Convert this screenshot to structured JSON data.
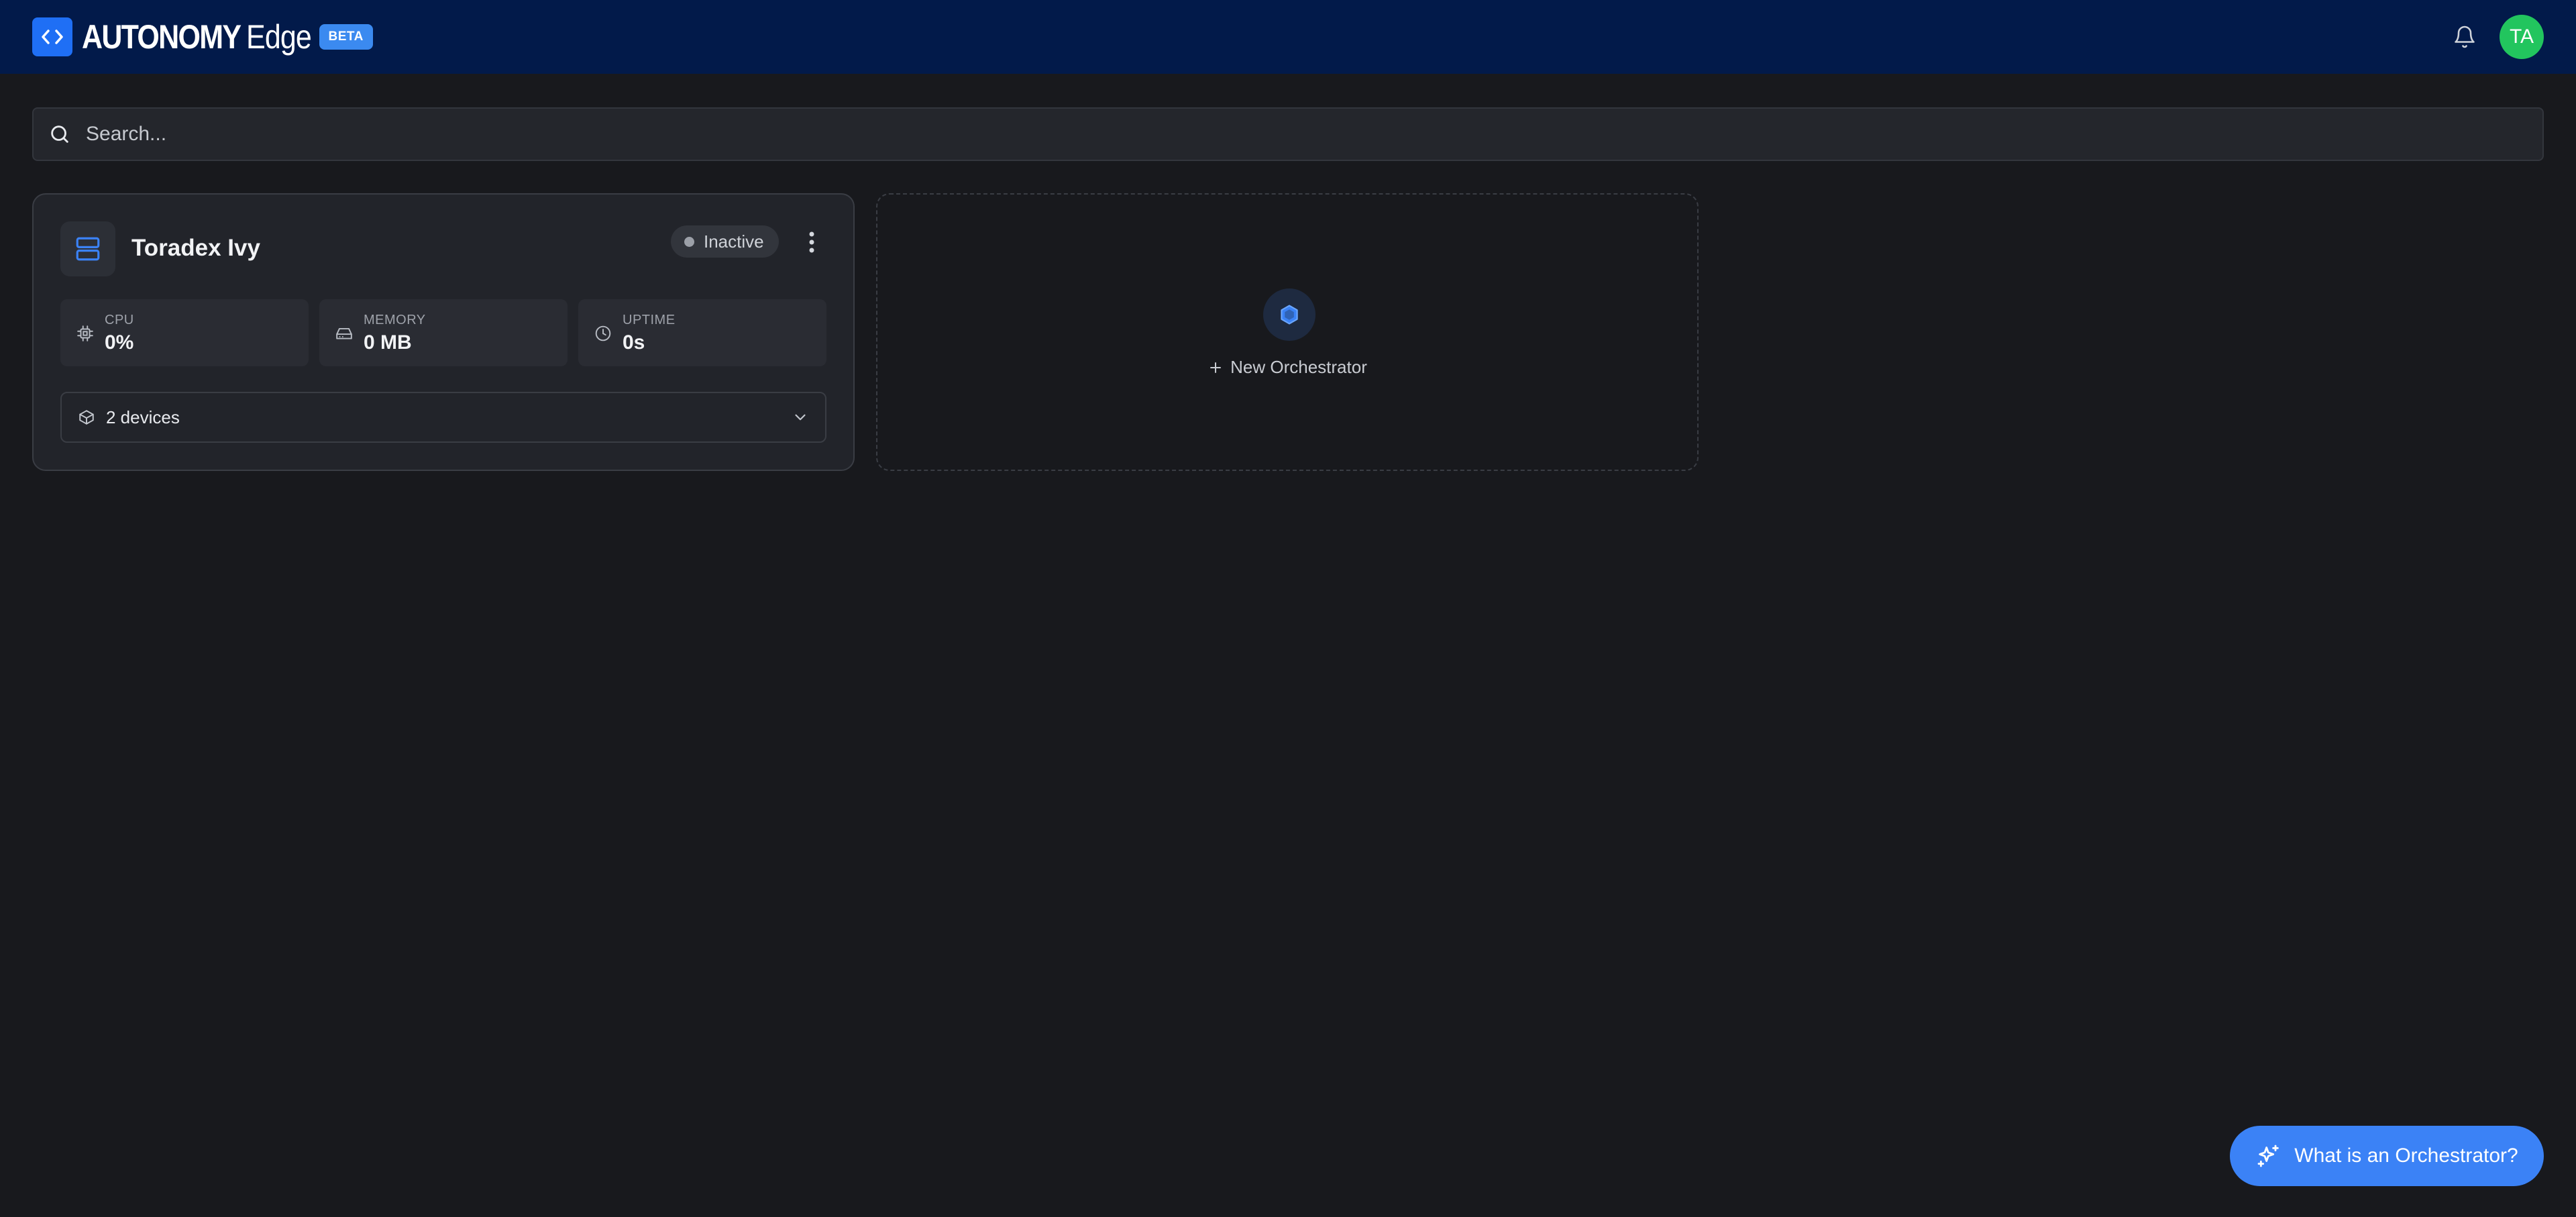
{
  "header": {
    "brand_name": "AUTONOMY",
    "brand_suffix": "Edge",
    "badge": "BETA",
    "avatar_initials": "TA",
    "logo_icon": "code-brackets-icon",
    "bell_icon": "bell-icon"
  },
  "search": {
    "placeholder": "Search...",
    "value": ""
  },
  "orchestrators": [
    {
      "name": "Toradex Ivy",
      "status": "Inactive",
      "metrics": [
        {
          "label": "CPU",
          "value": "0%",
          "icon": "cpu-icon"
        },
        {
          "label": "MEMORY",
          "value": "0 MB",
          "icon": "hard-drive-icon"
        },
        {
          "label": "UPTIME",
          "value": "0s",
          "icon": "clock-icon"
        }
      ],
      "devices_label": "2 devices"
    }
  ],
  "new_orchestrator": {
    "label": "New Orchestrator"
  },
  "help_button": {
    "label": "What is an Orchestrator?"
  },
  "colors": {
    "background": "#18191d",
    "header": "#021a4a",
    "accent": "#3b82f6",
    "avatar": "#22c55e",
    "card": "#22242a"
  }
}
